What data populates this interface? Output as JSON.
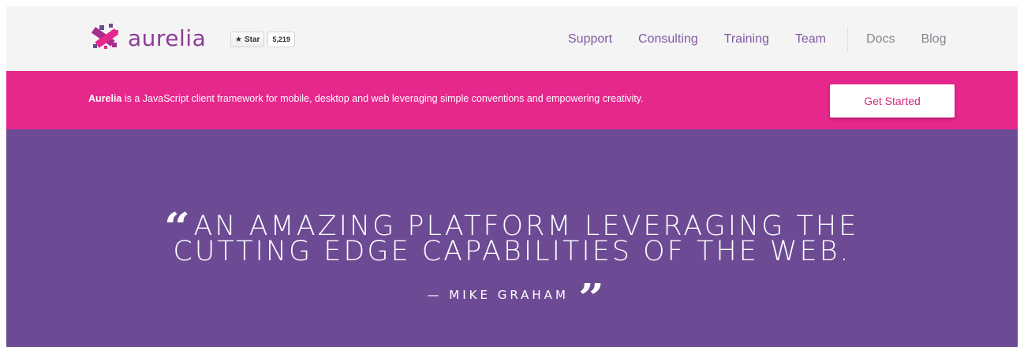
{
  "brand": {
    "name": "aurelia",
    "logo_icon": "aurelia-logo-icon",
    "color": "#8b3d96"
  },
  "github": {
    "star_label": "Star",
    "star_count": "5,219",
    "icon": "star-icon"
  },
  "nav": {
    "main": [
      "Support",
      "Consulting",
      "Training",
      "Team"
    ],
    "secondary": [
      "Docs",
      "Blog"
    ]
  },
  "banner": {
    "brand_word": "Aurelia",
    "tagline": " is a JavaScript client framework for mobile, desktop and web leveraging simple conventions and empowering creativity.",
    "cta_label": "Get Started"
  },
  "hero": {
    "quote_line_1": "AN AMAZING PLATFORM LEVERAGING THE",
    "quote_line_2": "CUTTING EDGE CAPABILITIES OF THE WEB.",
    "author": "— MIKE GRAHAM",
    "open_quote_glyph": "“",
    "close_quote_glyph": "”"
  },
  "colors": {
    "header_bg": "#f5f4f4",
    "banner_bg": "#e6278c",
    "hero_bg": "#6c4b94",
    "nav_link": "#7e5aa5",
    "nav_secondary": "#8a8391"
  }
}
